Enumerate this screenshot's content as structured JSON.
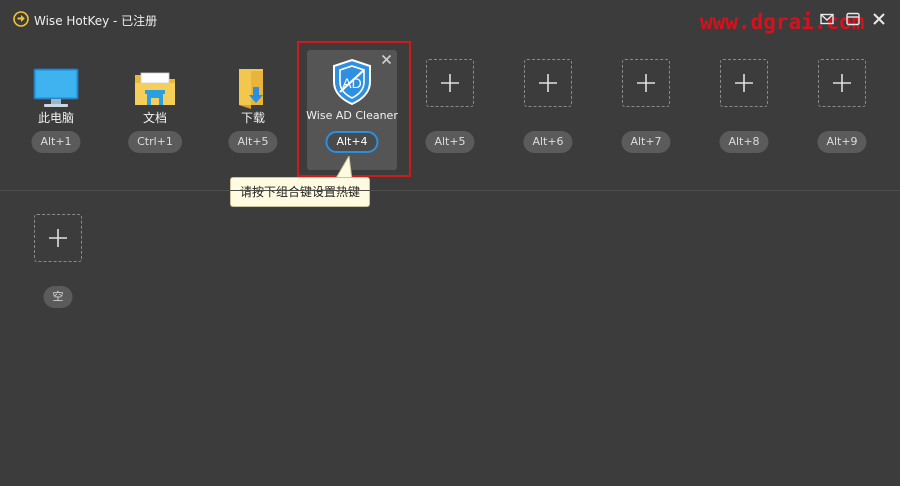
{
  "window": {
    "title": "Wise HotKey - 已注册",
    "watermark": "www.dgrai.com",
    "accent_color": "#2b8fe0",
    "highlight_color": "#d01a1a"
  },
  "row1": [
    {
      "label": "此电脑",
      "hotkey": "Alt+1",
      "icon": "monitor-icon"
    },
    {
      "label": "文档",
      "hotkey": "Ctrl+1",
      "icon": "documents-folder-icon"
    },
    {
      "label": "下载",
      "hotkey": "Alt+5",
      "icon": "downloads-folder-icon"
    },
    {
      "label": "Wise AD Cleaner",
      "hotkey": "Alt+4",
      "icon": "ad-shield-icon",
      "selected": true
    },
    {
      "label": "",
      "hotkey": "Alt+5",
      "icon": "plus-icon"
    },
    {
      "label": "",
      "hotkey": "Alt+6",
      "icon": "plus-icon"
    },
    {
      "label": "",
      "hotkey": "Alt+7",
      "icon": "plus-icon"
    },
    {
      "label": "",
      "hotkey": "Alt+8",
      "icon": "plus-icon"
    },
    {
      "label": "",
      "hotkey": "Alt+9",
      "icon": "plus-icon"
    }
  ],
  "tooltip": {
    "text": "请按下组合键设置热键"
  },
  "row2": [
    {
      "label": "",
      "hotkey": "空",
      "icon": "plus-icon"
    }
  ]
}
